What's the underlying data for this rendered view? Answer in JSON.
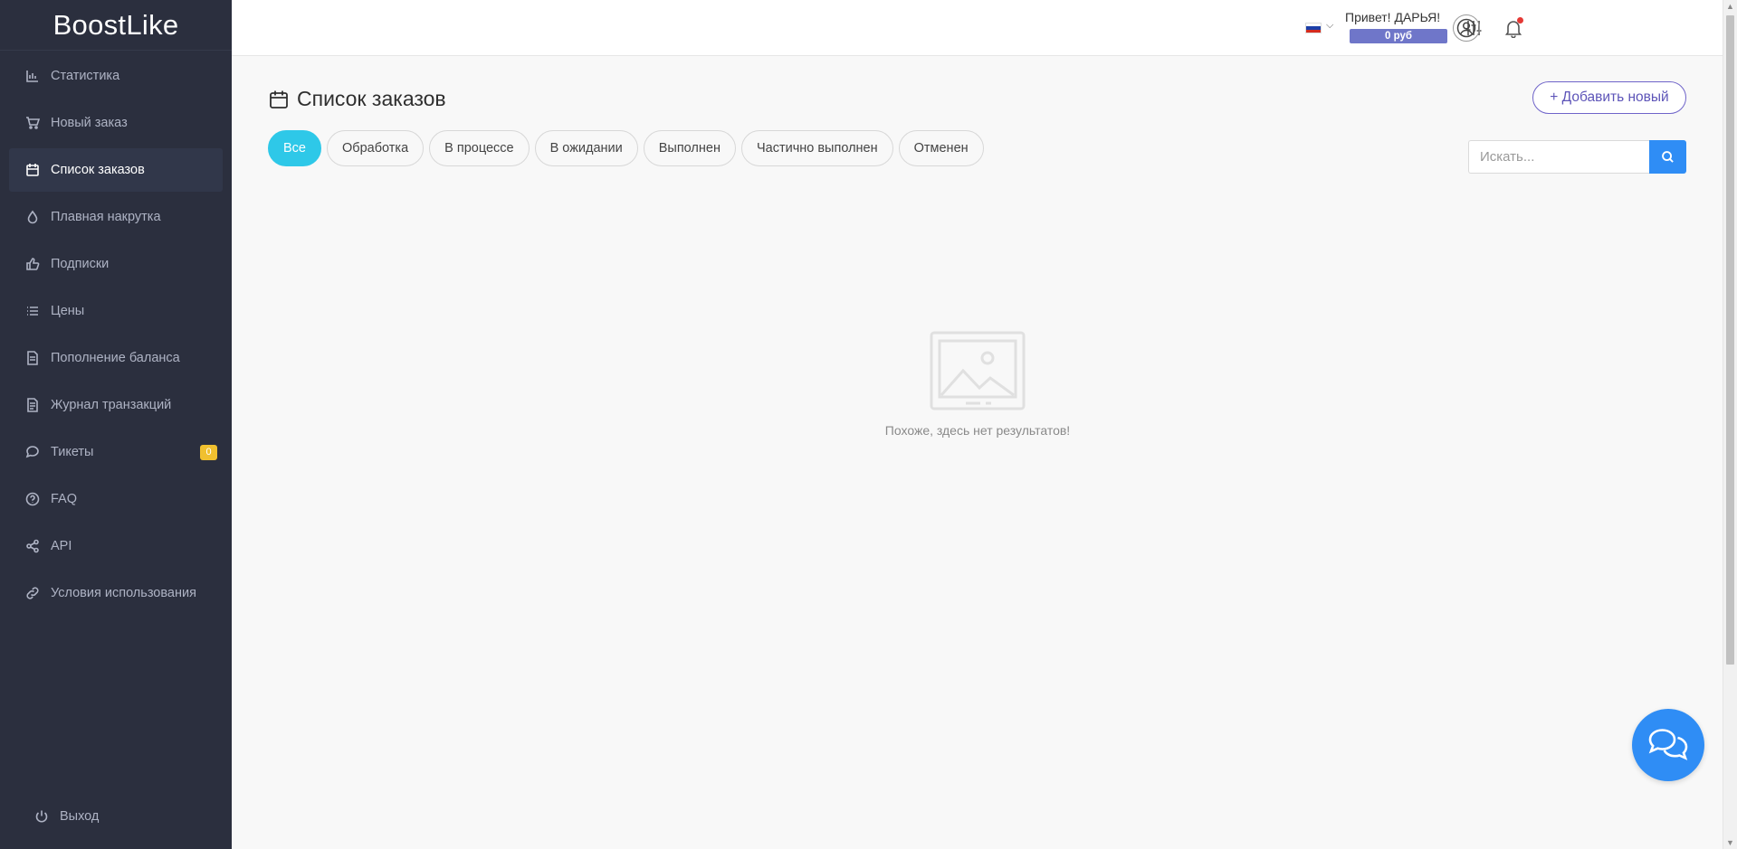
{
  "brand": {
    "logo_text": "BoostLike"
  },
  "sidebar": {
    "items": [
      {
        "label": "Статистика",
        "icon": "bar-chart-icon"
      },
      {
        "label": "Новый заказ",
        "icon": "cart-icon"
      },
      {
        "label": "Список заказов",
        "icon": "calendar-icon",
        "active": true
      },
      {
        "label": "Плавная накрутка",
        "icon": "drop-icon"
      },
      {
        "label": "Подписки",
        "icon": "thumbs-up-icon"
      },
      {
        "label": "Цены",
        "icon": "list-icon"
      },
      {
        "label": "Пополнение баланса",
        "icon": "document-icon"
      },
      {
        "label": "Журнал транзакций",
        "icon": "journal-icon"
      },
      {
        "label": "Тикеты",
        "icon": "chat-icon",
        "badge": "0"
      },
      {
        "label": "FAQ",
        "icon": "help-icon"
      },
      {
        "label": "API",
        "icon": "share-icon"
      },
      {
        "label": "Условия использования",
        "icon": "link-icon"
      }
    ],
    "logout": {
      "label": "Выход",
      "icon": "power-icon"
    }
  },
  "header": {
    "greeting": "Привет! ДАРЬЯ!",
    "balance": "0 руб",
    "language_flag": "ru-flag-icon",
    "notification_dot_color": "#e53935"
  },
  "main": {
    "title": "Список заказов",
    "add_button": "+ Добавить новый",
    "filters": [
      "Все",
      "Обработка",
      "В процессе",
      "В ожидании",
      "Выполнен",
      "Частично выполнен",
      "Отменен"
    ],
    "active_filter": "Все",
    "search": {
      "placeholder": "Искать...",
      "value": ""
    },
    "empty_text": "Похоже, здесь нет результатов!"
  },
  "colors": {
    "sidebar_bg": "#2b2f3e",
    "active_filter": "#2ec8e8",
    "primary": "#2f8df5",
    "accent": "#6f64c9",
    "balance_bg": "#6f76c9",
    "badge": "#f0c02f"
  }
}
